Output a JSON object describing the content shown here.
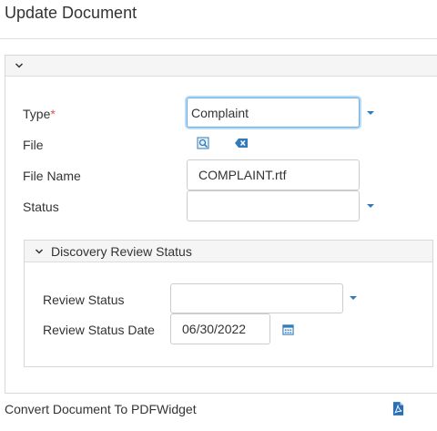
{
  "page": {
    "title": "Update Document"
  },
  "form": {
    "type_label": "Type",
    "type_required_mark": "*",
    "type_value": "Complaint",
    "file_label": "File",
    "file_name_label": "File Name",
    "file_name_value": "COMPLAINT.rtf",
    "status_label": "Status",
    "status_value": ""
  },
  "discovery": {
    "title": "Discovery Review Status",
    "review_status_label": "Review Status",
    "review_status_value": "",
    "review_status_date_label": "Review Status Date",
    "review_status_date_value": "06/30/2022"
  },
  "footer": {
    "convert_label": "Convert Document To PDFWidget"
  },
  "icons": {
    "collapse": "chevron-down-icon",
    "dropdown": "caret-down-icon",
    "file_view": "file-search-icon",
    "clear": "backspace-icon",
    "calendar": "calendar-icon",
    "pdf": "pdf-icon"
  },
  "colors": {
    "accent": "#337ab7",
    "required": "#d9534f",
    "focus": "#66afe9",
    "pdf": "#2a6fb5"
  }
}
